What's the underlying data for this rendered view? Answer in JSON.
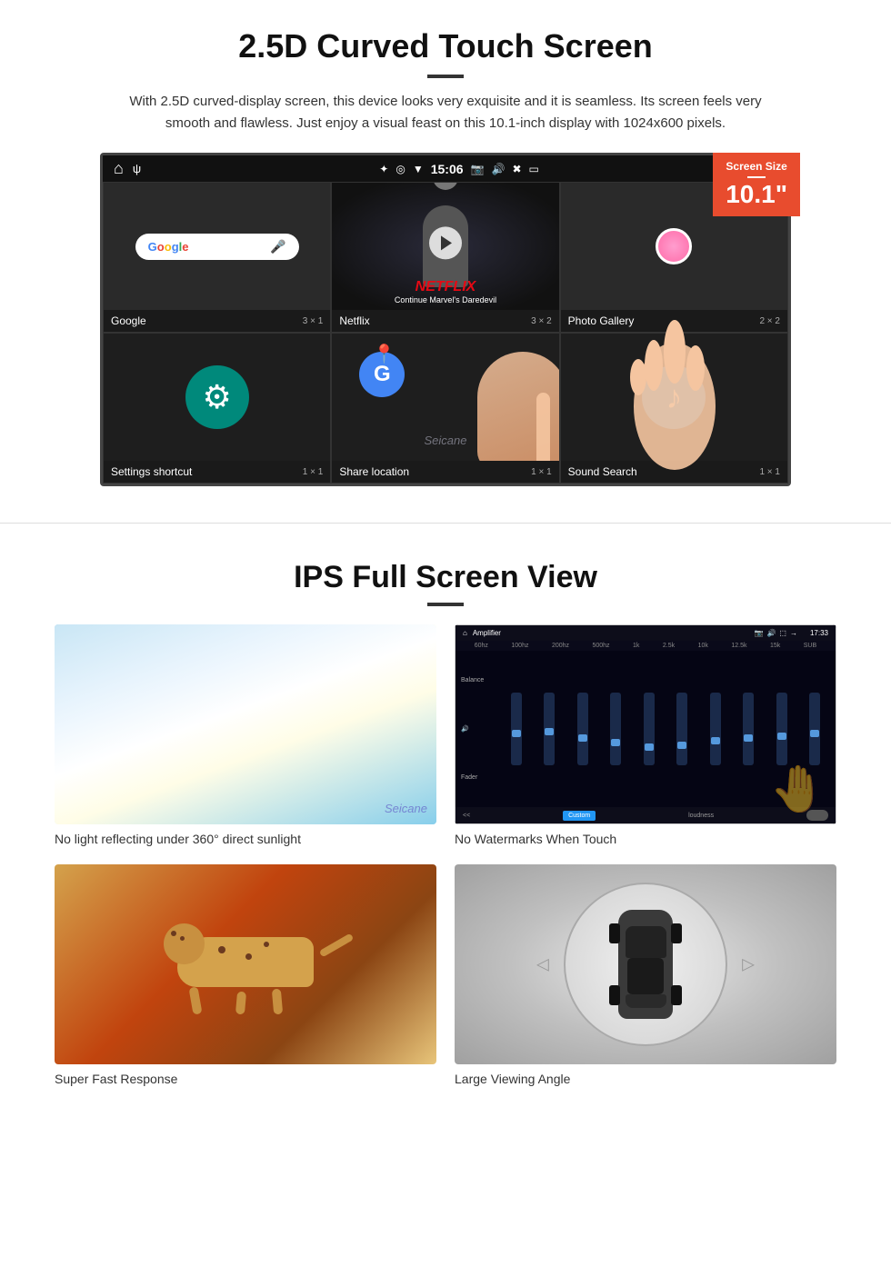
{
  "section1": {
    "title": "2.5D Curved Touch Screen",
    "description": "With 2.5D curved-display screen, this device looks very exquisite and it is seamless. Its screen feels very smooth and flawless. Just enjoy a visual feast on this 10.1-inch display with 1024x600 pixels.",
    "badge": {
      "label": "Screen Size",
      "size": "10.1\""
    },
    "status_bar": {
      "time": "15:06"
    },
    "apps": [
      {
        "name": "Google",
        "size": "3 × 1"
      },
      {
        "name": "Netflix",
        "size": "3 × 2"
      },
      {
        "name": "Photo Gallery",
        "size": "2 × 2"
      },
      {
        "name": "Settings shortcut",
        "size": "1 × 1"
      },
      {
        "name": "Share location",
        "size": "1 × 1"
      },
      {
        "name": "Sound Search",
        "size": "1 × 1"
      }
    ],
    "netflix": {
      "logo": "NETFLIX",
      "subtitle": "Continue Marvel's Daredevil"
    },
    "watermark": "Seicane"
  },
  "section2": {
    "title": "IPS Full Screen View",
    "features": [
      {
        "caption": "No light reflecting under 360° direct sunlight",
        "type": "sunlight"
      },
      {
        "caption": "No Watermarks When Touch",
        "type": "amplifier"
      },
      {
        "caption": "Super Fast Response",
        "type": "cheetah"
      },
      {
        "caption": "Large Viewing Angle",
        "type": "car"
      }
    ],
    "amp": {
      "title": "Amplifier",
      "time": "17:33",
      "labels": [
        "60hz",
        "100hz",
        "200hz",
        "500hz",
        "1k",
        "2.5k",
        "10k",
        "12.5k",
        "15k",
        "SUB"
      ],
      "left_labels": [
        "Balance",
        "Fader"
      ],
      "custom_btn": "Custom",
      "loudness_label": "loudness"
    }
  }
}
